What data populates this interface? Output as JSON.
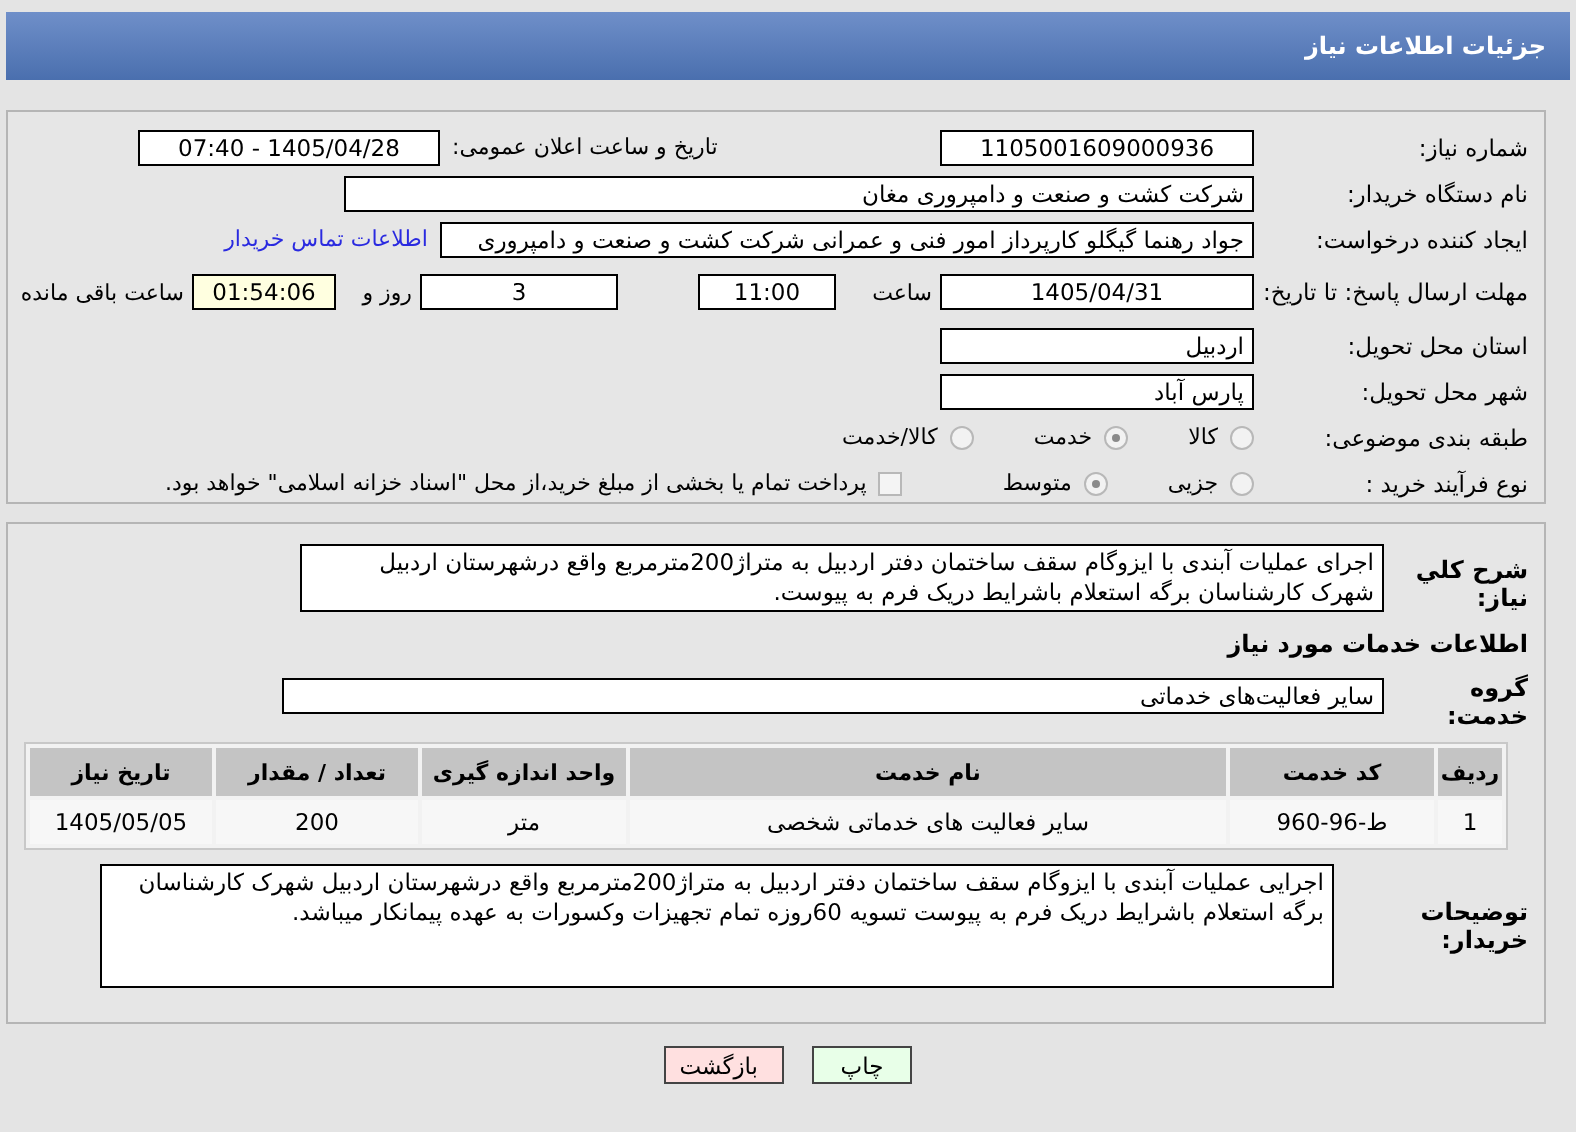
{
  "header": {
    "title": "جزئیات اطلاعات نیاز"
  },
  "need_number": {
    "label": "شماره نیاز:",
    "value": "1105001609000936"
  },
  "announce": {
    "label": "تاریخ و ساعت اعلان عمومی:",
    "value": "1405/04/28 - 07:40"
  },
  "buyer": {
    "label": "نام دستگاه خریدار:",
    "value": "شرکت کشت و صنعت و دامپروری مغان"
  },
  "creator": {
    "label": "ایجاد کننده درخواست:",
    "value": "جواد رهنما گیگلو کارپرداز امور فنی و عمرانی  شرکت کشت و صنعت و دامپروری",
    "link": "اطلاعات تماس خریدار"
  },
  "deadline": {
    "label": "مهلت ارسال پاسخ: تا تاریخ:",
    "date": "1405/04/31",
    "time_label": "ساعت",
    "time": "11:00",
    "days": "3",
    "days_label": "روز و",
    "remaining": "01:54:06",
    "remaining_label": "ساعت باقی مانده"
  },
  "province": {
    "label": "استان محل تحویل:",
    "value": "اردبیل"
  },
  "city": {
    "label": "شهر محل تحویل:",
    "value": "پارس آباد"
  },
  "category": {
    "label": "طبقه بندی موضوعی:",
    "options": [
      {
        "label": "کالا",
        "selected": false
      },
      {
        "label": "خدمت",
        "selected": true
      },
      {
        "label": "کالا/خدمت",
        "selected": false
      }
    ]
  },
  "purchase_type": {
    "label": "نوع فرآیند خرید :",
    "options": [
      {
        "label": "جزیی",
        "selected": false
      },
      {
        "label": "متوسط",
        "selected": true
      }
    ],
    "payment": {
      "label": "پرداخت تمام یا بخشی از مبلغ خرید،از محل \"اسناد خزانه اسلامی\" خواهد بود.",
      "checked": false
    }
  },
  "description": {
    "label": "شرح کلي نياز:",
    "value": "اجرای عملیات آبندی با ایزوگام سقف ساختمان دفتر اردبیل به متراژ200مترمربع  واقع درشهرستان اردبیل شهرک کارشناسان برگه استعلام باشرایط دریک فرم به پیوست."
  },
  "services_title": "اطلاعات خدمات مورد نیاز",
  "service_group": {
    "label": "گروه خدمت:",
    "value": "سایر فعالیت‌های خدماتی"
  },
  "table": {
    "columns": [
      "ردیف",
      "کد خدمت",
      "نام خدمت",
      "واحد اندازه گیری",
      "تعداد / مقدار",
      "تاریخ نیاز"
    ],
    "rows": [
      [
        "1",
        "ط-96-960",
        "سایر فعالیت های خدماتی شخصی",
        "متر",
        "200",
        "1405/05/05"
      ]
    ]
  },
  "buyer_notes": {
    "label": "توضیحات خریدار:",
    "value": "اجرایی عملیات آبندی با ایزوگام سقف ساختمان دفتر اردبیل به متراژ200مترمربع  واقع درشهرستان اردبیل شهرک کارشناسان برگه استعلام باشرایط دریک فرم به پیوست تسویه 60روزه تمام تجهیزات وکسورات به عهده پیمانکار میباشد."
  },
  "buttons": [
    {
      "label": "چاپ",
      "kind": "print"
    },
    {
      "label": "بازگشت",
      "kind": "back"
    }
  ]
}
